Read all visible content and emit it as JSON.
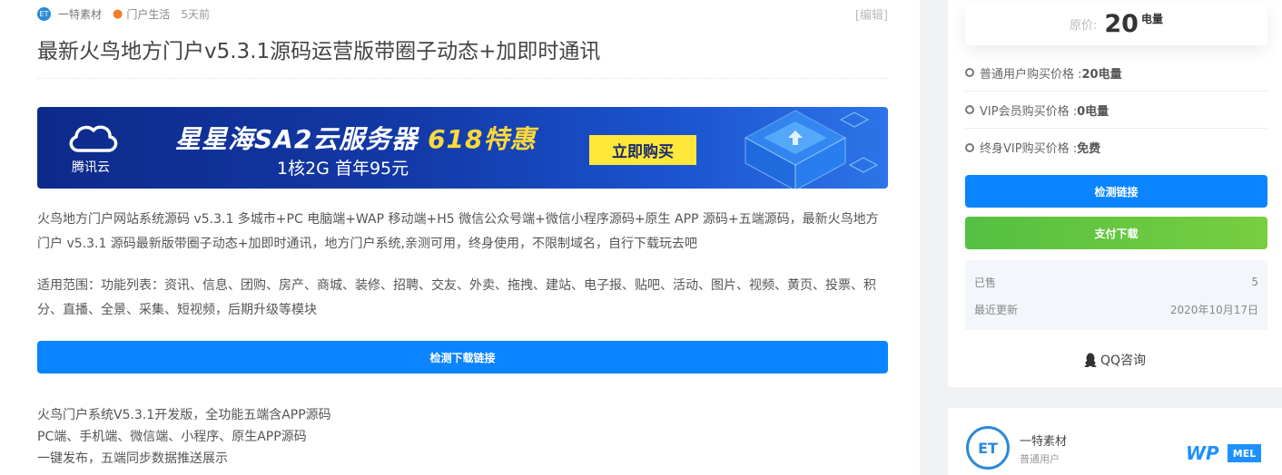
{
  "post": {
    "meta": {
      "author": "一特素材",
      "category": "门户生活",
      "time": "5天前",
      "edit": "[编辑]"
    },
    "title": "最新火鸟地方门户v5.3.1源码运营版带圈子动态+加即时通讯",
    "banner": {
      "brand": "腾讯云",
      "headline_main": "星星海SA2云服务器 ",
      "headline_highlight": "618特惠",
      "subline": "1核2G 首年95元",
      "cta": "立即购买"
    },
    "paragraph1": "火鸟地方门户网站系统源码 v5.3.1 多城市+PC 电脑端+WAP 移动端+H5 微信公众号端+微信小程序源码+原生 APP 源码+五端源码，最新火鸟地方门户 v5.3.1 源码最新版带圈子动态+加即时通讯，地方门户系统,亲测可用，终身使用，不限制域名，自行下载玩去吧",
    "paragraph2": "适用范围：功能列表：资讯、信息、团购、房产、商城、装修、招聘、交友、外卖、拖拽、建站、电子报、贴吧、活动、图片、视频、黄页、投票、积分、直播、全景、采集、短视频，后期升级等模块",
    "check_button": "检测下载链接",
    "features": [
      "火鸟门户系统V5.3.1开发版，全功能五端含APP源码",
      "PC端、手机端、微信端、小程序、原生APP源码",
      "一键发布，五端同步数据推送展示"
    ]
  },
  "sidebar": {
    "price": {
      "label": "原价:",
      "value": "20",
      "unit": "电量"
    },
    "price_rows": [
      {
        "label": "普通用户购买价格 : ",
        "value": "20电量"
      },
      {
        "label": "VIP会员购买价格 : ",
        "value": "0电量"
      },
      {
        "label": "终身VIP购买价格 : ",
        "value": "免费"
      }
    ],
    "check_link": "检测链接",
    "download": "支付下载",
    "stats": [
      {
        "label": "已售",
        "value": "5"
      },
      {
        "label": "最近更新",
        "value": "2020年10月17日"
      }
    ],
    "qq": "QQ咨询"
  },
  "author_card": {
    "name": "一特素材",
    "role": "普通用户",
    "watermark": "WP",
    "watermark_tag": "MEL"
  },
  "colors": {
    "accent_blue": "#0a84ff",
    "download_green": "#5cc242",
    "banner_highlight": "#ffd93b"
  }
}
